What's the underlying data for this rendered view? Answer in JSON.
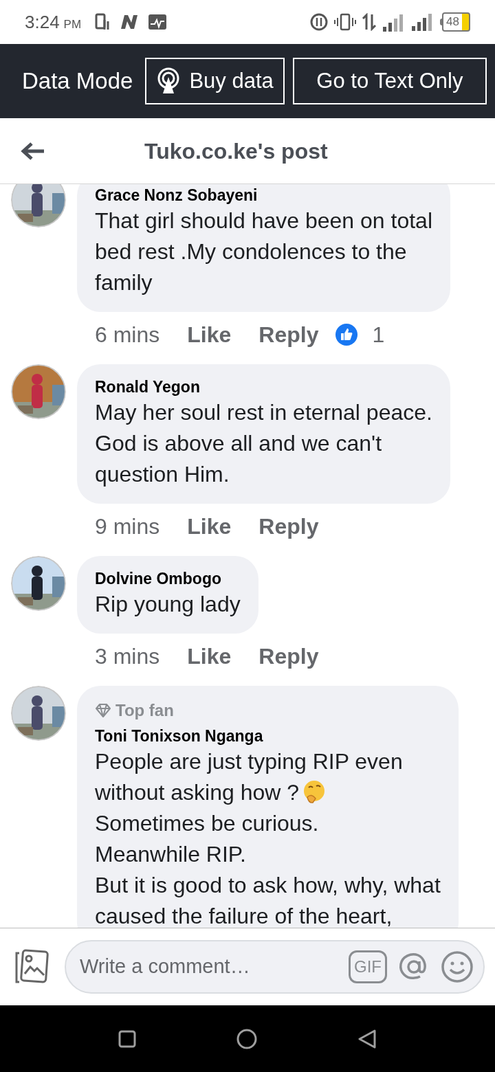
{
  "status_bar": {
    "time": "3:24",
    "period": "PM",
    "battery": "48"
  },
  "data_bar": {
    "label": "Data Mode",
    "buttons": [
      {
        "kind": "buy",
        "label": "Buy data"
      },
      {
        "kind": "plain",
        "label": "Go to Text Only"
      }
    ]
  },
  "header": {
    "title": "Tuko.co.ke's post"
  },
  "comments": [
    {
      "author": "Grace Nonz Sobayeni",
      "segments": [
        {
          "kind": "text",
          "text": "That girl should have been on total\nbed rest .My condolences to the\nfamily"
        }
      ],
      "time": "6 mins",
      "like": "Like",
      "reply": "Reply",
      "reactions": "1"
    },
    {
      "author": "Ronald Yegon",
      "segments": [
        {
          "kind": "text",
          "text": "May her soul rest in eternal peace.\nGod is above all and we can't\nquestion Him."
        }
      ],
      "time": "9 mins",
      "like": "Like",
      "reply": "Reply"
    },
    {
      "author": "Dolvine Ombogo",
      "segments": [
        {
          "kind": "text",
          "text": "Rip young lady"
        }
      ],
      "time": "3 mins",
      "like": "Like",
      "reply": "Reply"
    },
    {
      "author": "Toni Tonixson Nganga",
      "top_fan": true,
      "badge": "Top fan",
      "segments": [
        {
          "kind": "text",
          "text": "People are just typing RIP even"
        },
        {
          "kind": "text",
          "text": "without asking how ?"
        },
        {
          "kind": "emoji"
        },
        {
          "kind": "text",
          "text": "Sometimes be curious.\nMeanwhile RIP.\nBut it is good to ask how, why, what\ncaused the failure of the heart,"
        }
      ]
    }
  ],
  "composer": {
    "placeholder": "Write a comment…",
    "gif": "GIF"
  }
}
